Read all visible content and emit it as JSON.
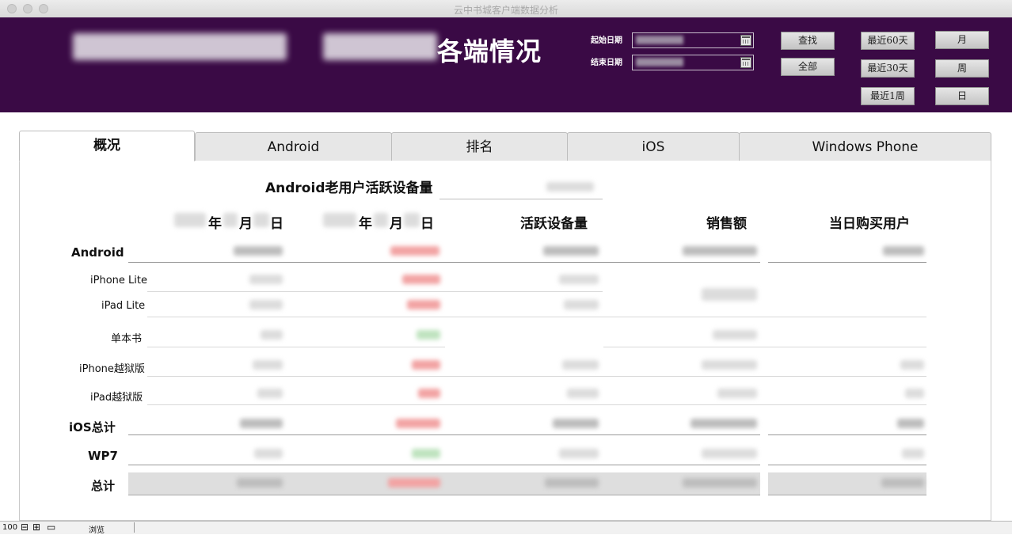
{
  "window": {
    "title": "云中书城客户端数据分析"
  },
  "header": {
    "title": "各端情况",
    "start_date_label": "起始日期",
    "end_date_label": "结束日期",
    "buttons": {
      "search": "查找",
      "all": "全部",
      "last60": "最近60天",
      "last30": "最近30天",
      "last1week": "最近1周",
      "month": "月",
      "week": "周",
      "day": "日"
    }
  },
  "tabs": [
    "概况",
    "Android",
    "排名",
    "iOS",
    "Windows Phone"
  ],
  "summary": {
    "label": "Android老用户活跃设备量"
  },
  "columns": {
    "col_a_year": "年",
    "col_a_month": "月",
    "col_a_day": "日",
    "col_b_year": "年",
    "col_b_month": "月",
    "col_b_day": "日",
    "active_devices": "活跃设备量",
    "sales": "销售额",
    "buyers": "当日购买用户"
  },
  "rows": {
    "android": "Android",
    "iphone_lite": "iPhone Lite",
    "ipad_lite": "iPad Lite",
    "single_book": "单本书",
    "iphone_jb": "iPhone越狱版",
    "ipad_jb": "iPad越狱版",
    "ios_total": "iOS总计",
    "wp7": "WP7",
    "total": "总计"
  },
  "statusbar": {
    "zoom": "100",
    "mode": "浏览"
  },
  "colors": {
    "header_bg": "#3a0a45",
    "increase": "#f2a3a3",
    "decrease": "#bfe3bf"
  }
}
